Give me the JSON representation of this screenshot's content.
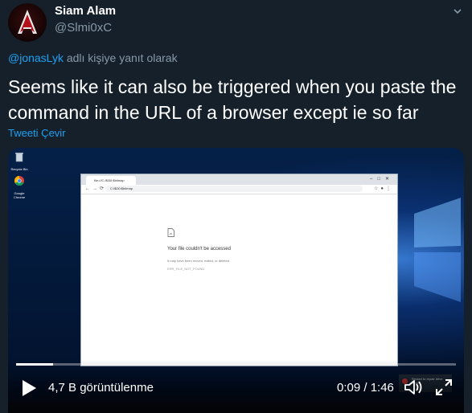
{
  "author": {
    "name": "Siam Alam",
    "handle": "@Slmi0xC"
  },
  "reply_context": {
    "mention": "@jonasLyk",
    "suffix": " adlı kişiye yanıt olarak"
  },
  "tweet": {
    "text": "Seems like it can also be triggered when you paste the command in the URL of a browser except ie so far",
    "translate_label": "Tweeti Çevir"
  },
  "video": {
    "views": "4,7 B görüntülenme",
    "time": "0:09 / 1:46",
    "progress_fraction": 0.085,
    "desktop_icons": [
      {
        "icon": "recycle-bin-icon",
        "label": "Recycle Bin"
      },
      {
        "icon": "chrome-icon",
        "label": "Google Chrome"
      }
    ],
    "browser": {
      "tab_title": "file:///C:/$i30:$bitmap",
      "url": "C:/$i30:$bitmap",
      "error_title": "Your file couldn't be accessed",
      "error_subtitle": "It may have been moved, edited, or deleted.",
      "error_code": "ERR_FILE_NOT_FOUND"
    },
    "notification": "Restart to repair drive errors"
  },
  "colors": {
    "background": "#15202b",
    "accent": "#1da1f2",
    "muted": "#8899a6"
  }
}
